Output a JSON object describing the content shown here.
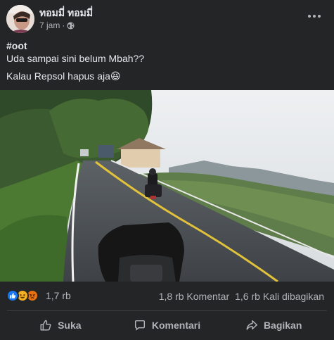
{
  "post": {
    "author": "ทอมมี่ ทอมมี่",
    "time": "7 jam",
    "privacy_icon": "globe-icon",
    "text": {
      "hashtag": "#oot",
      "line1": "Uda sampai sini belum Mbah??",
      "line2": "Kalau Repsol hapus aja",
      "line2_emoji": "😆"
    }
  },
  "reactions": {
    "icons": [
      "like-icon",
      "haha-icon",
      "angry-icon"
    ],
    "count": "1,7 rb",
    "comments": "1,8 rb Komentar",
    "shares": "1,6 rb Kali dibagikan"
  },
  "actions": {
    "like": "Suka",
    "comment": "Komentari",
    "share": "Bagikan"
  },
  "colors": {
    "background": "#242526",
    "text_primary": "#e4e6eb",
    "text_secondary": "#b0b3b8",
    "like_blue": "#1877f2"
  }
}
